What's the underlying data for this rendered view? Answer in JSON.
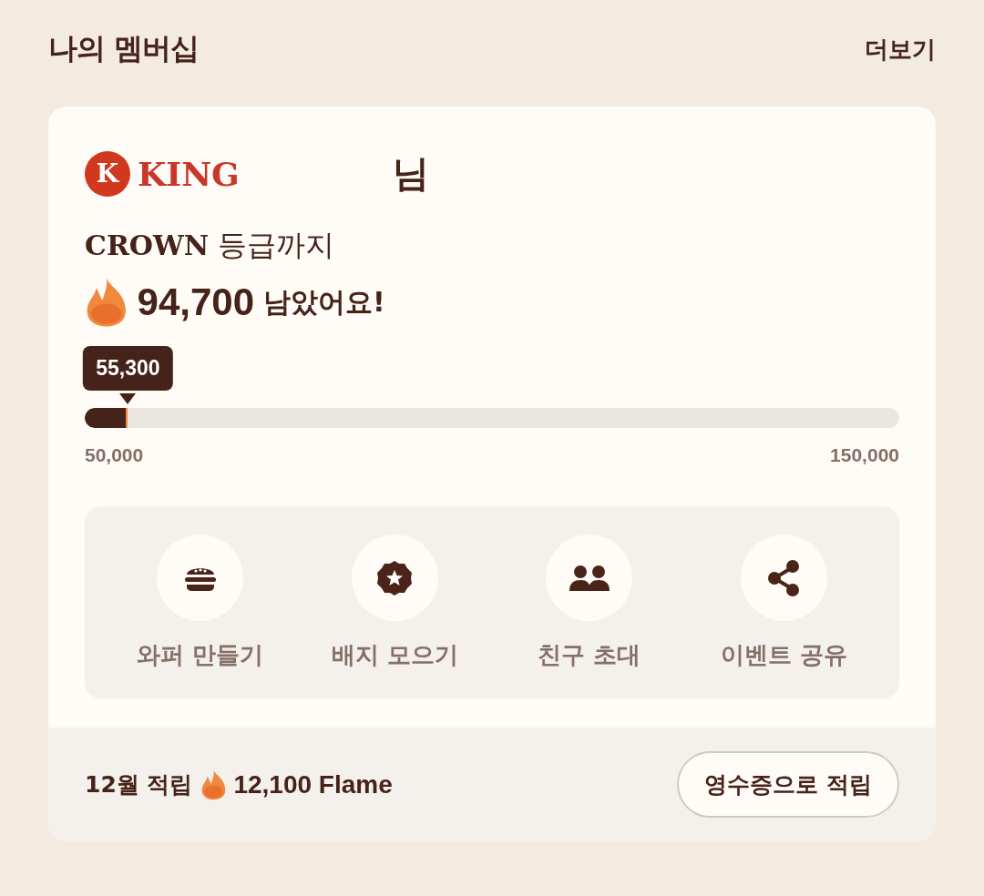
{
  "header": {
    "title": "나의 멤버십",
    "more_link": "더보기"
  },
  "membership": {
    "level_badge": {
      "letter": "K",
      "label": "KING"
    },
    "honorific": "님",
    "next_grade": "**CROWN** 등급까지",
    "remaining": {
      "amount": "94,700",
      "suffix": "남았어요!"
    },
    "progress": {
      "current": "55,300",
      "level": 0.053,
      "min": "50,000",
      "max": "150,000"
    },
    "actions": [
      {
        "kind": "burger",
        "label": "와퍼 만들기"
      },
      {
        "kind": "badge",
        "label": "배지 모으기"
      },
      {
        "kind": "friends",
        "label": "친구 초대"
      },
      {
        "kind": "share",
        "label": "이벤트 공유"
      }
    ]
  },
  "footer": {
    "month_label": "12월 적립",
    "earned": "12,100 Flame",
    "button": "영수증으로 적립"
  }
}
